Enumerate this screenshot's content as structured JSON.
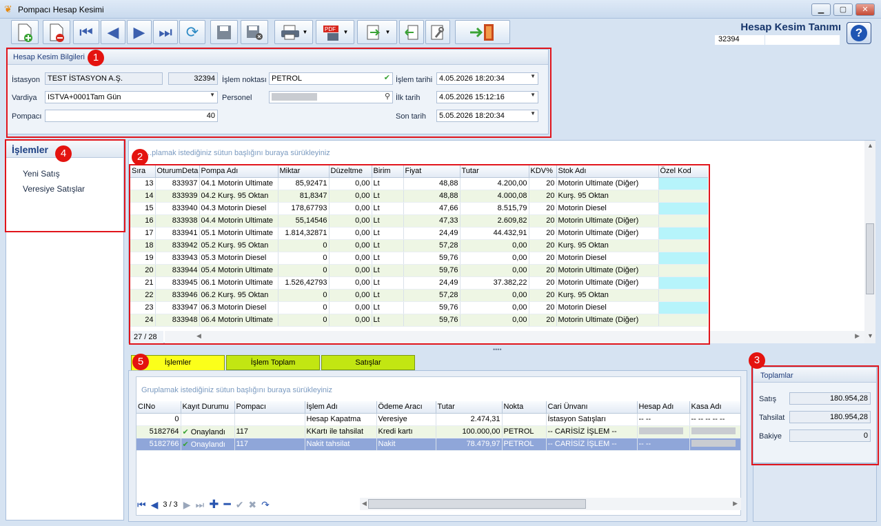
{
  "window": {
    "title": "Pompacı Hesap Kesimi",
    "minimize": "▁",
    "maximize": "▢",
    "close": "✕"
  },
  "header": {
    "title": "Hesap Kesim Tanımı",
    "id": "32394",
    "help": "?"
  },
  "badges": [
    "1",
    "2",
    "3",
    "4",
    "5"
  ],
  "info": {
    "group_title": "Hesap Kesim Bilgileri",
    "istasyon_label": "İstasyon",
    "istasyon_value": "TEST İSTASYON A.Ş.",
    "istasyon_code": "32394",
    "vardiya_label": "Vardiya",
    "vardiya_value": "ISTVA+0001Tam Gün",
    "pompaci_label": "Pompacı",
    "pompaci_value": "40",
    "islem_noktasi_label": "İşlem noktası",
    "islem_noktasi_value": "PETROL",
    "personel_label": "Personel",
    "personel_value": "",
    "islem_tarihi_label": "İşlem tarihi",
    "islem_tarihi_value": "4.05.2026 18:20:34",
    "ilk_tarih_label": "İlk tarih",
    "ilk_tarih_value": "4.05.2026 15:12:16",
    "son_tarih_label": "Son tarih",
    "son_tarih_value": "5.05.2026 18:20:34"
  },
  "islemler_panel": {
    "title": "İşlemler",
    "items": [
      "Yeni Satış",
      "Veresiye Satışlar"
    ]
  },
  "grid1": {
    "hint": "...plamak istediğiniz sütun başlığını buraya sürükleyiniz",
    "columns": [
      "Sıra",
      "OturumDeta",
      "Pompa Adı",
      "Miktar",
      "Düzeltme",
      "Birim",
      "Fiyat",
      "Tutar",
      "KDV%",
      "Stok Adı",
      "Özel Kod"
    ],
    "rows": [
      [
        "13",
        "833937",
        "04.1 Motorin Ultimate",
        "85,92471",
        "0,00",
        "Lt",
        "48,88",
        "4.200,00",
        "20",
        "Motorin Ultimate (Diğer)",
        ""
      ],
      [
        "14",
        "833939",
        "04.2 Kurş. 95 Oktan",
        "81,8347",
        "0,00",
        "Lt",
        "48,88",
        "4.000,08",
        "20",
        "Kurş. 95 Oktan",
        ""
      ],
      [
        "15",
        "833940",
        "04.3 Motorin Diesel",
        "178,67793",
        "0,00",
        "Lt",
        "47,66",
        "8.515,79",
        "20",
        "Motorin Diesel",
        ""
      ],
      [
        "16",
        "833938",
        "04.4 Motorin Ultimate",
        "55,14546",
        "0,00",
        "Lt",
        "47,33",
        "2.609,82",
        "20",
        "Motorin Ultimate (Diğer)",
        ""
      ],
      [
        "17",
        "833941",
        "05.1 Motorin Ultimate",
        "1.814,32871",
        "0,00",
        "Lt",
        "24,49",
        "44.432,91",
        "20",
        "Motorin Ultimate (Diğer)",
        ""
      ],
      [
        "18",
        "833942",
        "05.2 Kurş. 95 Oktan",
        "0",
        "0,00",
        "Lt",
        "57,28",
        "0,00",
        "20",
        "Kurş. 95 Oktan",
        ""
      ],
      [
        "19",
        "833943",
        "05.3 Motorin Diesel",
        "0",
        "0,00",
        "Lt",
        "59,76",
        "0,00",
        "20",
        "Motorin Diesel",
        ""
      ],
      [
        "20",
        "833944",
        "05.4 Motorin Ultimate",
        "0",
        "0,00",
        "Lt",
        "59,76",
        "0,00",
        "20",
        "Motorin Ultimate (Diğer)",
        ""
      ],
      [
        "21",
        "833945",
        "06.1 Motorin Ultimate",
        "1.526,42793",
        "0,00",
        "Lt",
        "24,49",
        "37.382,22",
        "20",
        "Motorin Ultimate (Diğer)",
        ""
      ],
      [
        "22",
        "833946",
        "06.2 Kurş. 95 Oktan",
        "0",
        "0,00",
        "Lt",
        "57,28",
        "0,00",
        "20",
        "Kurş. 95 Oktan",
        ""
      ],
      [
        "23",
        "833947",
        "06.3 Motorin Diesel",
        "0",
        "0,00",
        "Lt",
        "59,76",
        "0,00",
        "20",
        "Motorin Diesel",
        ""
      ],
      [
        "24",
        "833948",
        "06.4 Motorin Ultimate",
        "0",
        "0,00",
        "Lt",
        "59,76",
        "0,00",
        "20",
        "Motorin Ultimate (Diğer)",
        ""
      ]
    ],
    "pager": "27 / 28"
  },
  "tabs": [
    "İşlemler",
    "İşlem Toplam",
    "Satışlar"
  ],
  "grid2": {
    "hint": "Gruplamak istediğiniz sütun başlığını buraya sürükleyiniz",
    "columns": [
      "CINo",
      "Kayıt Durumu",
      "Pompacı",
      "İşlem Adı",
      "Ödeme Aracı",
      "Tutar",
      "Nokta",
      "Cari Ünvanı",
      "Hesap Adı",
      "Kasa Adı"
    ],
    "rows": [
      [
        "0",
        "",
        "",
        "Hesap Kapatma",
        "Veresiye",
        "2.474,31",
        "",
        "İstasyon Satışları",
        "-- --",
        "-- -- -- -- --"
      ],
      [
        "5182764",
        "Onaylandı",
        "117",
        "KKartı ile tahsilat",
        "Kredi kartı",
        "100.000,00",
        "PETROL",
        "-- CARİSİZ İŞLEM --",
        "",
        ""
      ],
      [
        "5182766",
        "Onaylandı",
        "117",
        "Nakit tahsilat",
        "Nakit",
        "78.479,97",
        "PETROL",
        "-- CARİSİZ İŞLEM --",
        "-- --",
        ""
      ]
    ],
    "pager": "3 / 3"
  },
  "totals": {
    "title": "Toplamlar",
    "satis_label": "Satış",
    "satis_value": "180.954,28",
    "tahsilat_label": "Tahsilat",
    "tahsilat_value": "180.954,28",
    "bakiye_label": "Bakiye",
    "bakiye_value": "0"
  },
  "colors": {
    "accent": "#e1141b",
    "tab_yellow": "#fbff1a",
    "tab_green": "#c2e612",
    "selection": "#8fa6d9",
    "ozel_kod": "#b6f4fb"
  }
}
